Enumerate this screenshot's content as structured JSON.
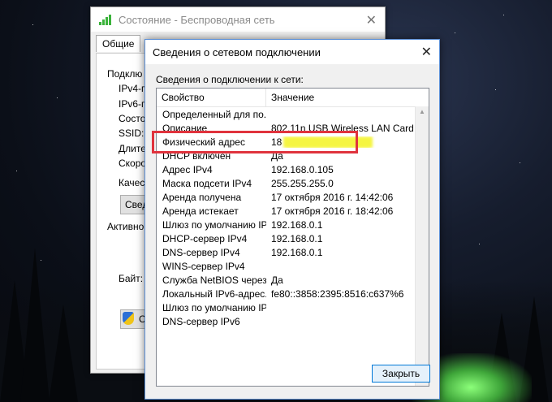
{
  "back_window": {
    "title": "Состояние - Беспроводная сеть",
    "tab_label": "Общие",
    "fragments": [
      "Подклю",
      "IPv4-п",
      "IPv6-п",
      "Состо",
      "SSID:",
      "Длите",
      "Скоро",
      "Качес",
      "Свед",
      "Активно",
      "Байт:",
      "С"
    ]
  },
  "dialog": {
    "title": "Сведения о сетевом подключении",
    "label": "Сведения о подключении к сети:",
    "columns": [
      "Свойство",
      "Значение"
    ],
    "rows": [
      {
        "prop": "Определенный для по...",
        "value": ""
      },
      {
        "prop": "Описание",
        "value": "802.11n USB Wireless LAN Card"
      },
      {
        "prop": "Физический адрес",
        "value": "18"
      },
      {
        "prop": "DHCP включен",
        "value": "Да"
      },
      {
        "prop": "Адрес IPv4",
        "value": "192.168.0.105"
      },
      {
        "prop": "Маска подсети IPv4",
        "value": "255.255.255.0"
      },
      {
        "prop": "Аренда получена",
        "value": "17 октября 2016 г. 14:42:06"
      },
      {
        "prop": "Аренда истекает",
        "value": "17 октября 2016 г. 18:42:06"
      },
      {
        "prop": "Шлюз по умолчанию IP...",
        "value": "192.168.0.1"
      },
      {
        "prop": "DHCP-сервер IPv4",
        "value": "192.168.0.1"
      },
      {
        "prop": "DNS-сервер IPv4",
        "value": "192.168.0.1"
      },
      {
        "prop": "WINS-сервер IPv4",
        "value": ""
      },
      {
        "prop": "Служба NetBIOS через...",
        "value": "Да"
      },
      {
        "prop": "Локальный IPv6-адрес...",
        "value": "fe80::3858:2395:8516:c637%6"
      },
      {
        "prop": "Шлюз по умолчанию IP...",
        "value": ""
      },
      {
        "prop": "DNS-сервер IPv6",
        "value": ""
      }
    ],
    "close_label": "Закрыть"
  },
  "colors": {
    "highlight": "#e0333d",
    "accent": "#0078d7",
    "mac_blur": "#f5f542"
  }
}
